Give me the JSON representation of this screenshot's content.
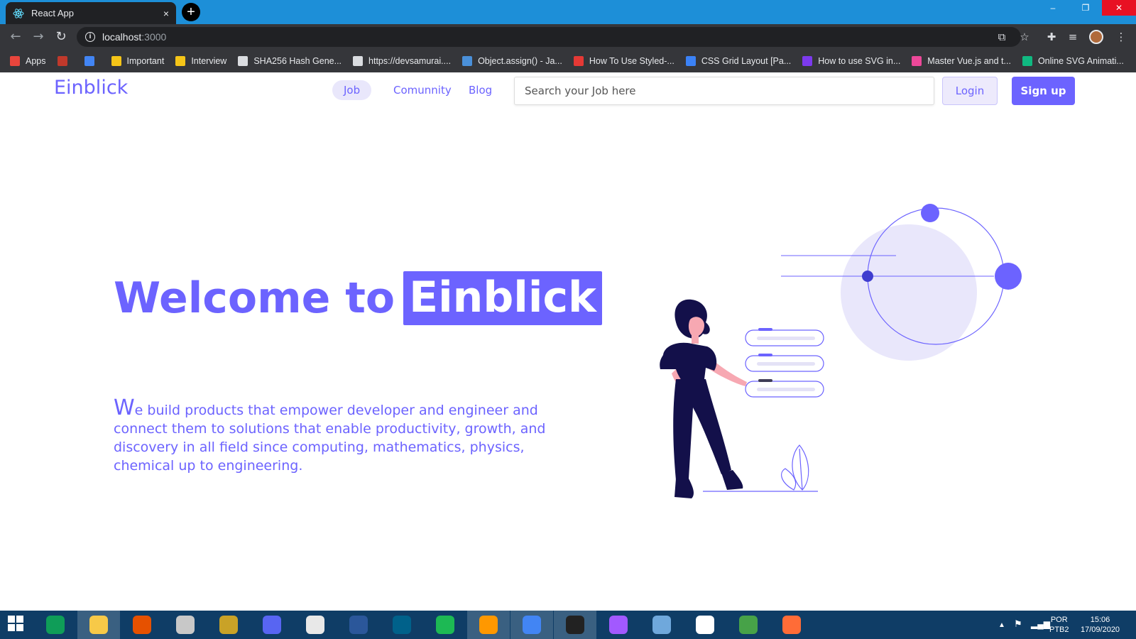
{
  "browser": {
    "tab_title": "React App",
    "tab_close": "×",
    "new_tab": "+",
    "url_host": "localhost",
    "url_port": ":3000",
    "window_controls": {
      "minimize": "–",
      "restore": "❐",
      "close": "✕"
    },
    "bookmarks": [
      {
        "label": "Apps",
        "icon": "apps-grid-icon",
        "color": "#e8453c"
      },
      {
        "label": "",
        "icon": "oxford-icon",
        "color": "#c0392b"
      },
      {
        "label": "",
        "icon": "google-translate-icon",
        "color": "#4285f4"
      },
      {
        "label": "Important",
        "icon": "folder-icon",
        "color": "#f5c518"
      },
      {
        "label": "Interview",
        "icon": "folder-icon",
        "color": "#f5c518"
      },
      {
        "label": "SHA256 Hash Gene...",
        "icon": "globe-icon",
        "color": "#dadce0"
      },
      {
        "label": "https://devsamurai....",
        "icon": "globe-icon",
        "color": "#dadce0"
      },
      {
        "label": "Object.assign() - Ja...",
        "icon": "mdn-icon",
        "color": "#4a90d9"
      },
      {
        "label": "How To Use Styled-...",
        "icon": "scotch-icon",
        "color": "#e53935"
      },
      {
        "label": "CSS Grid Layout [Pa...",
        "icon": "grid-site-icon",
        "color": "#3b82f6"
      },
      {
        "label": "How to use SVG in...",
        "icon": "feather-icon",
        "color": "#7c3aed"
      },
      {
        "label": "Master Vue.js and t...",
        "icon": "vue-mastery-icon",
        "color": "#ec4899"
      },
      {
        "label": "Online SVG Animati...",
        "icon": "svg-anim-icon",
        "color": "#10b981"
      }
    ]
  },
  "navbar": {
    "brand": "Einblick",
    "links": [
      {
        "label": "Job",
        "active": true
      },
      {
        "label": "Comunnity",
        "active": false
      },
      {
        "label": "Blog",
        "active": false
      }
    ],
    "search_placeholder": "Search your Job here",
    "login_label": "Login",
    "signup_label": "Sign up"
  },
  "hero": {
    "title_prefix": "Welcome to",
    "title_highlight": "Einblick",
    "desc_first_letter": "W",
    "desc_rest": "e build products that empower developer and engineer and connect them to solutions that enable productivity, growth, and discovery in all field since computing, mathematics, physics, chemical up to engineering."
  },
  "colors": {
    "accent": "#6c63ff",
    "accent_light": "#e9e7fb",
    "figure_dark": "#13104a",
    "skin": "#f7a8b2"
  },
  "taskbar": {
    "apps": [
      "windows-start-icon",
      "calculator-icon",
      "file-explorer-icon",
      "matlab-icon",
      "snipping-tool-icon",
      "league-of-legends-icon",
      "discord-icon",
      "slack-icon",
      "word-icon",
      "mysql-workbench-icon",
      "spotify-icon",
      "sublime-text-icon",
      "chrome-icon",
      "terminal-icon",
      "figma-icon",
      "paint-icon",
      "notion-icon",
      "mongodb-icon",
      "postman-icon"
    ],
    "language_top": "POR",
    "language_bottom": "PTB2",
    "time": "15:06",
    "date": "17/09/2020"
  }
}
